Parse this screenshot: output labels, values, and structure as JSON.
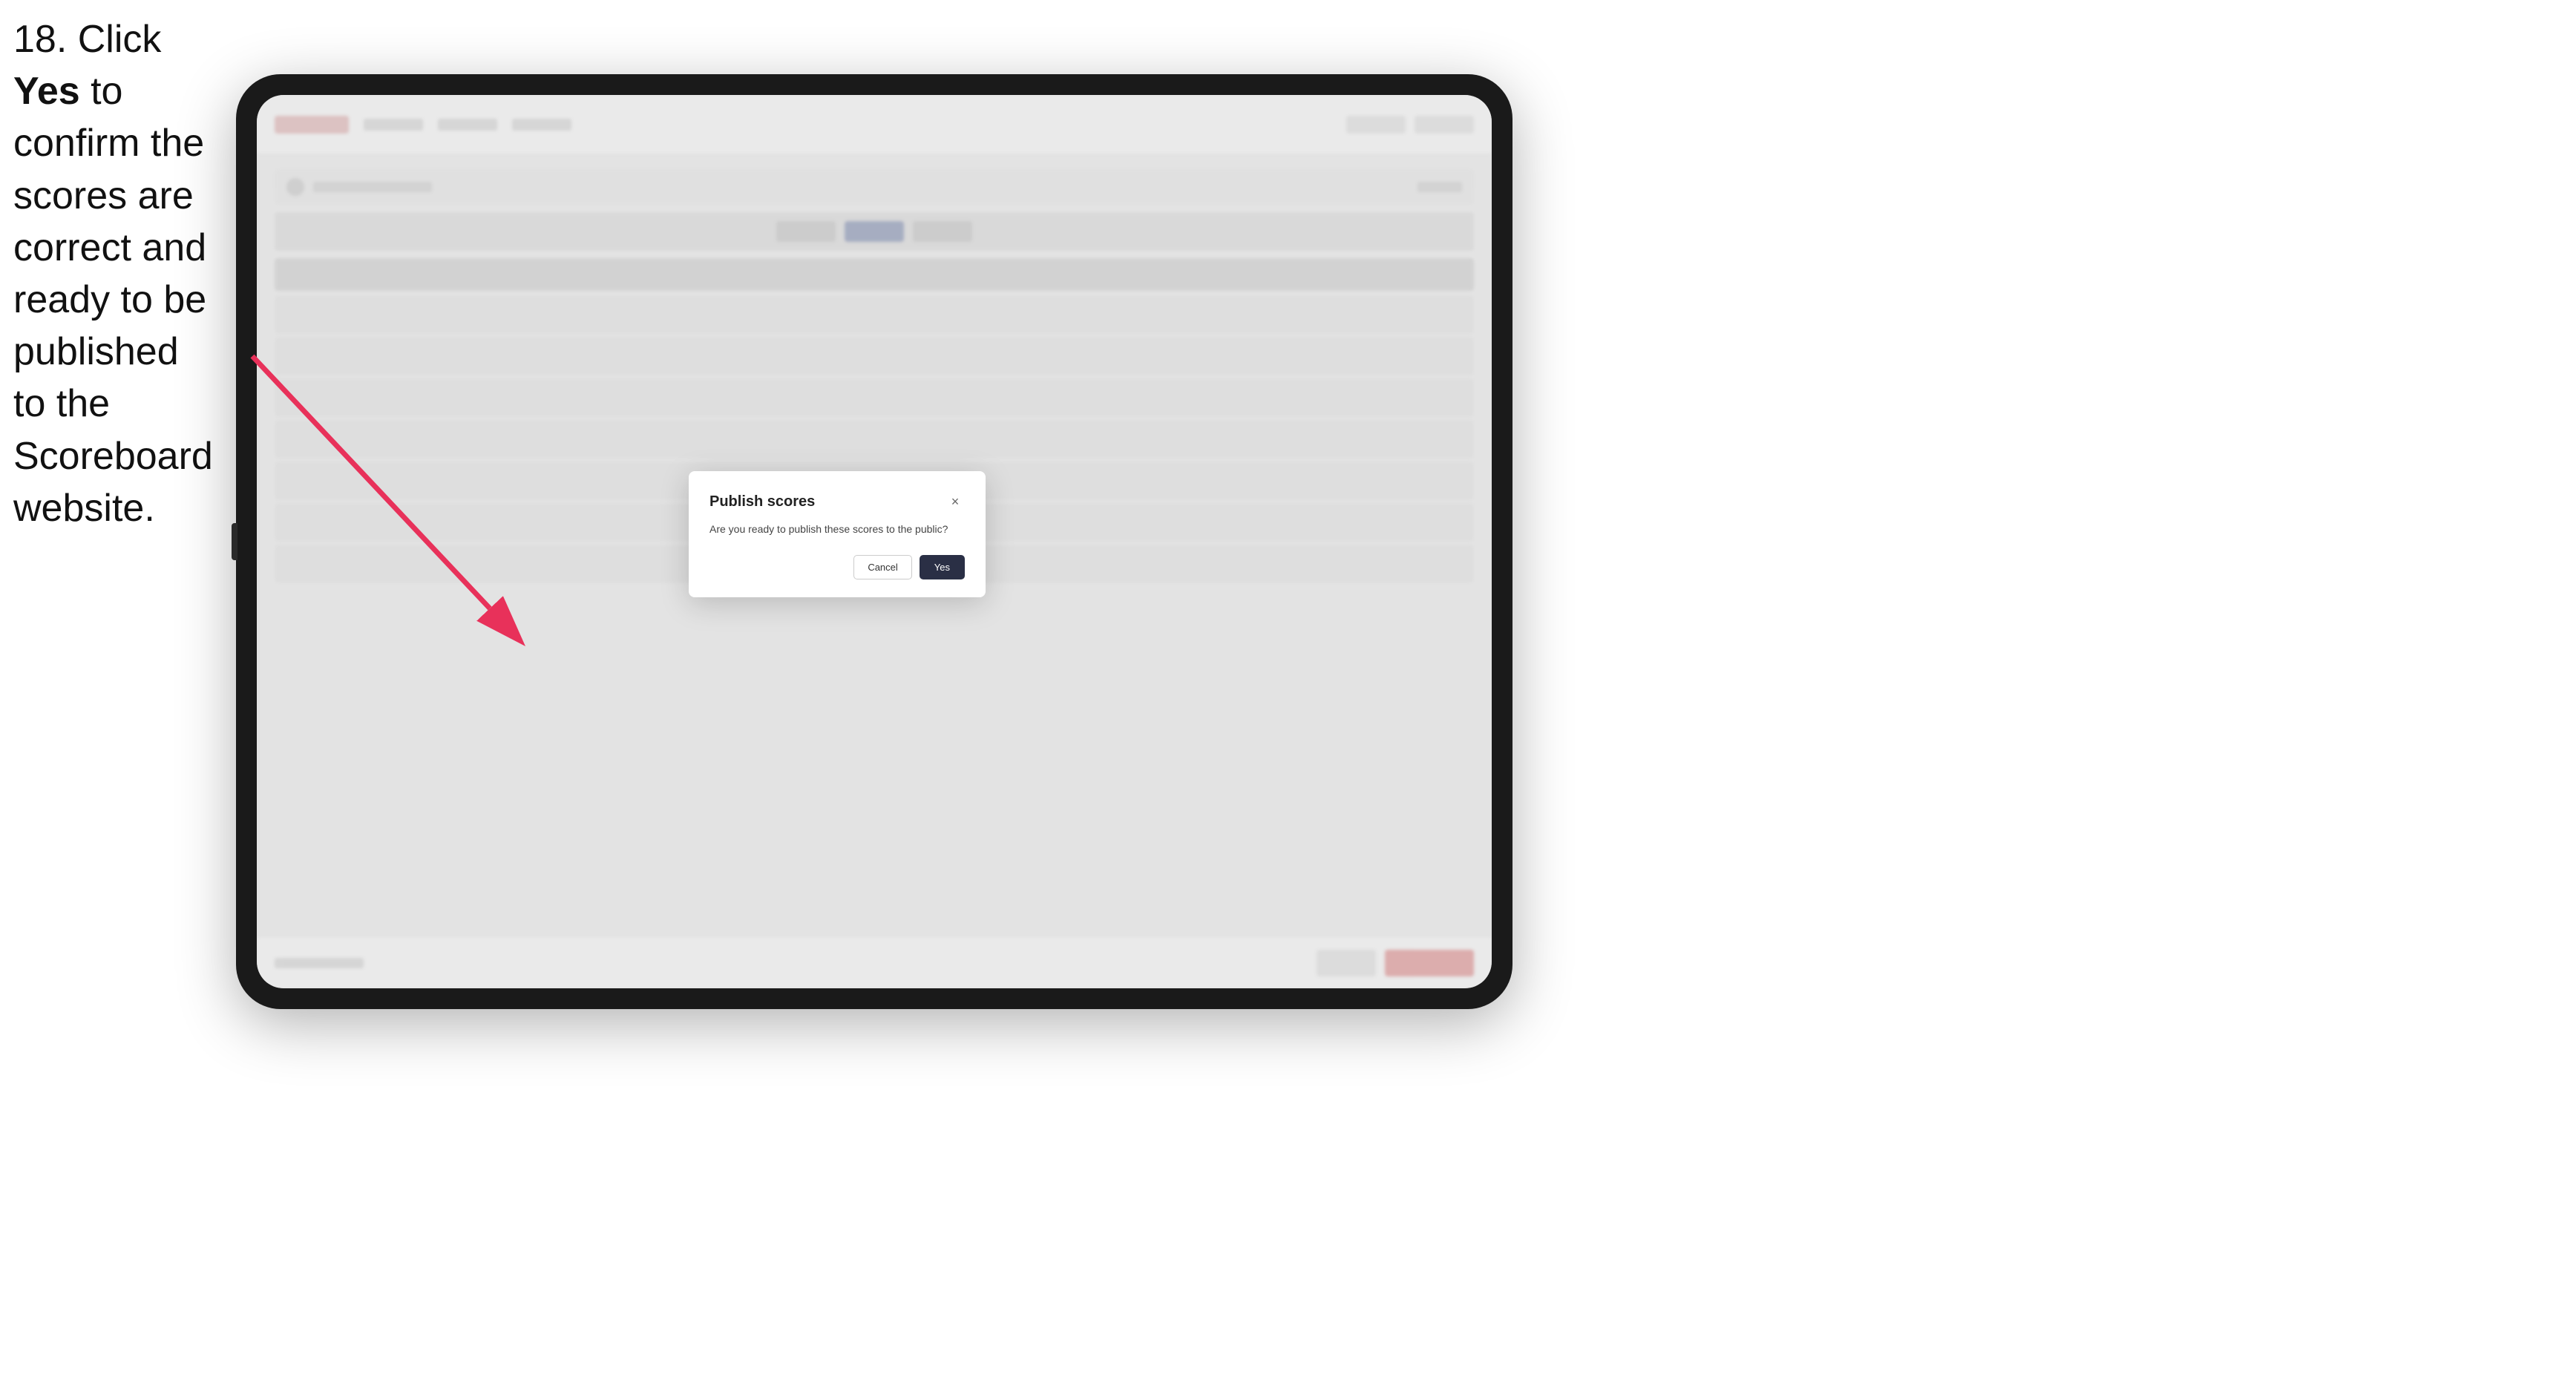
{
  "instruction": {
    "step_number": "18.",
    "text_part1": " Click ",
    "bold_word": "Yes",
    "text_part2": " to confirm the scores are correct and ready to be published to the Scoreboard website."
  },
  "tablet": {
    "screen_bg": "#f0f0f0"
  },
  "modal": {
    "title": "Publish scores",
    "body_text": "Are you ready to publish these scores to the public?",
    "cancel_label": "Cancel",
    "yes_label": "Yes",
    "close_icon": "×"
  },
  "arrow": {
    "color": "#e8315a"
  }
}
